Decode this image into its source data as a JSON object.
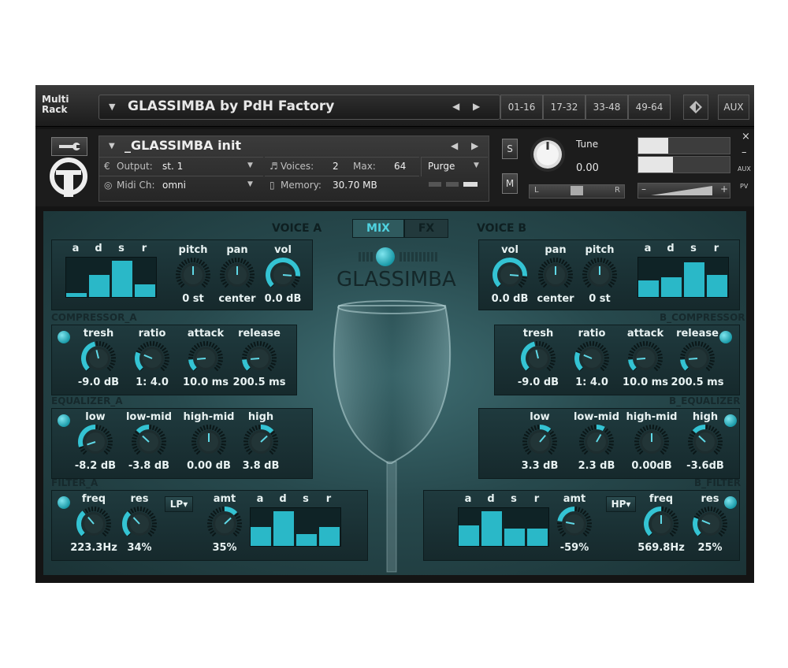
{
  "rack": {
    "title_line1": "Multi",
    "title_line2": "Rack",
    "multi_name": "GLASSIMBA by PdH Factory",
    "page_tabs": [
      "01-16",
      "17-32",
      "33-48",
      "49-64"
    ],
    "aux_label": "AUX"
  },
  "instrument": {
    "name": "_GLASSIMBA init",
    "output_label": "Output:",
    "output_value": "st. 1",
    "midi_label": "Midi Ch:",
    "midi_value": "omni",
    "voices_label": "Voices:",
    "voices_value": "2",
    "max_label": "Max:",
    "max_value": "64",
    "memory_label": "Memory:",
    "memory_value": "30.70 MB",
    "purge_label": "Purge",
    "solo_label": "S",
    "mute_label": "M",
    "tune_label": "Tune",
    "tune_value": "0.00",
    "pan_left": "L",
    "pan_right": "R",
    "close_glyph": "×",
    "minimize_glyph": "–",
    "aux_small": "AUX",
    "pv_small": "PV",
    "vol_minus": "–",
    "vol_plus": "+"
  },
  "ui": {
    "voice_a_title": "VOICE A",
    "voice_b_title": "VOICE B",
    "mix_tab": "MIX",
    "fx_tab": "FX",
    "logo_text": "GLASSIMBA",
    "adsr_labels": [
      "a",
      "d",
      "s",
      "r"
    ],
    "voice_a": {
      "pitch_label": "pitch",
      "pitch_value": "0 st",
      "pan_label": "pan",
      "pan_value": "center",
      "vol_label": "vol",
      "vol_value": "0.0 dB",
      "adsr_levels": [
        0.1,
        0.6,
        1.0,
        0.35
      ]
    },
    "voice_b": {
      "vol_label": "vol",
      "vol_value": "0.0 dB",
      "pan_label": "pan",
      "pan_value": "center",
      "pitch_label": "pitch",
      "pitch_value": "0 st",
      "adsr_levels": [
        0.45,
        0.55,
        0.95,
        0.6
      ]
    },
    "compressor_a": {
      "title": "COMPRESSOR_A",
      "labels": [
        "tresh",
        "ratio",
        "attack",
        "release"
      ],
      "values": [
        "-9.0 dB",
        "1: 4.0",
        "10.0 ms",
        "200.5 ms"
      ]
    },
    "compressor_b": {
      "title": "B_COMPRESSOR",
      "labels": [
        "tresh",
        "ratio",
        "attack",
        "release"
      ],
      "values": [
        "-9.0 dB",
        "1: 4.0",
        "10.0 ms",
        "200.5 ms"
      ]
    },
    "equalizer_a": {
      "title": "EQUALIZER_A",
      "labels": [
        "low",
        "low-mid",
        "high-mid",
        "high"
      ],
      "values": [
        "-8.2 dB",
        "-3.8 dB",
        "0.00 dB",
        "3.8 dB"
      ]
    },
    "equalizer_b": {
      "title": "B_EQUALIZER",
      "labels": [
        "low",
        "low-mid",
        "high-mid",
        "high"
      ],
      "values": [
        "3.3 dB",
        "2.3 dB",
        "0.00dB",
        "-3.6dB"
      ]
    },
    "filter_a": {
      "title": "FILTER_A",
      "freq_label": "freq",
      "freq_value": "223.3Hz",
      "res_label": "res",
      "res_value": "34%",
      "type_label": "LP▾",
      "amt_label": "amt",
      "amt_value": "35%",
      "adsr_levels": [
        0.55,
        1.0,
        0.35,
        0.55
      ]
    },
    "filter_b": {
      "title": "B_FILTER",
      "freq_label": "freq",
      "freq_value": "569.8Hz",
      "res_label": "res",
      "res_value": "25%",
      "type_label": "HP▾",
      "amt_label": "amt",
      "amt_value": "-59%",
      "adsr_levels": [
        0.6,
        1.0,
        0.5,
        0.5
      ]
    }
  }
}
